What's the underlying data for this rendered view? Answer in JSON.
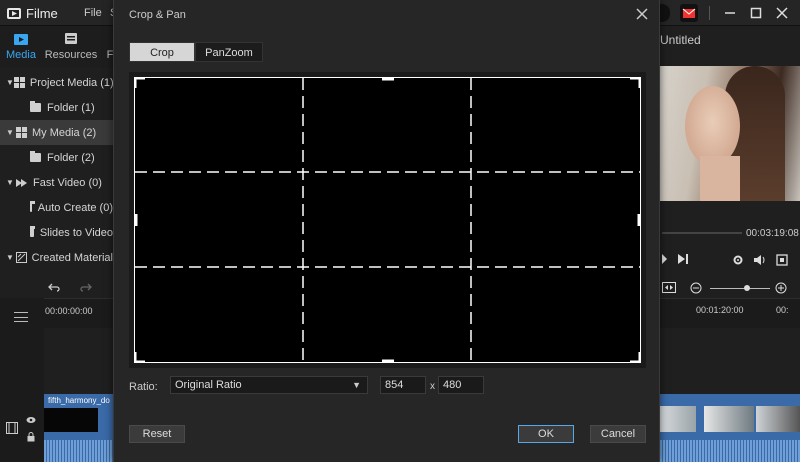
{
  "app": {
    "name": "Filme",
    "menu_file": "File",
    "menu_cut": "S"
  },
  "left_tabs": [
    {
      "label": "Media",
      "active": true
    },
    {
      "label": "Resources",
      "active": false
    },
    {
      "label": "F",
      "active": false
    }
  ],
  "tree": [
    {
      "label": "Project Media (1)",
      "type": "group",
      "selected": false
    },
    {
      "label": "Folder (1)",
      "type": "folder",
      "selected": false
    },
    {
      "label": "My Media (2)",
      "type": "group",
      "selected": true
    },
    {
      "label": "Folder (2)",
      "type": "folder",
      "selected": false
    },
    {
      "label": "Fast Video (0)",
      "type": "fast",
      "selected": false
    },
    {
      "label": "Auto Create (0)",
      "type": "folder",
      "selected": false
    },
    {
      "label": "Slides to Video",
      "type": "folder",
      "selected": false
    },
    {
      "label": "Created Material",
      "type": "created",
      "selected": false
    }
  ],
  "project": {
    "title": "Untitled"
  },
  "player": {
    "duration": "00:03:19:08"
  },
  "timeline": {
    "start_time": "00:00:00:00",
    "mark_time": "00:01:20:00",
    "mark_time2": "00:",
    "clip_name": "fifth_harmony_do"
  },
  "dialog": {
    "title": "Crop & Pan",
    "tabs": [
      {
        "label": "Crop",
        "active": true
      },
      {
        "label": "PanZoom",
        "active": false
      }
    ],
    "ratio_label": "Ratio:",
    "ratio_value": "Original Ratio",
    "width": "854",
    "times": "x",
    "height": "480",
    "reset_label": "Reset",
    "ok_label": "OK",
    "cancel_label": "Cancel"
  },
  "colors": {
    "accent": "#39a7f0",
    "ok_border": "#58a8e8",
    "clip": "#3a6aa8"
  },
  "icons": {
    "logo": "filme-logo-icon",
    "close": "close-icon",
    "minimize": "minimize-icon",
    "maximize": "maximize-icon"
  }
}
